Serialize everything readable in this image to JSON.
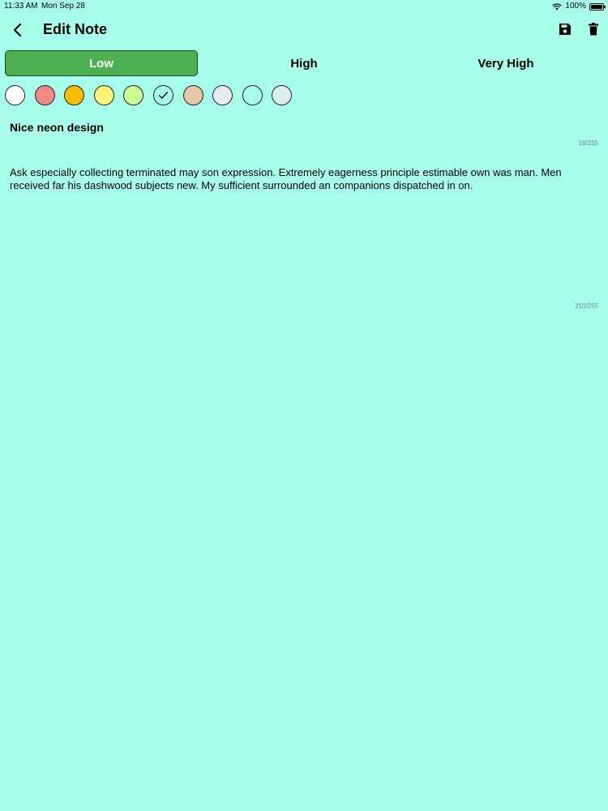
{
  "status_bar": {
    "time": "11:33 AM",
    "date": "Mon Sep 28",
    "battery": "100%"
  },
  "header": {
    "title": "Edit Note",
    "back_icon": "chevron-left-icon",
    "save_icon": "save-icon",
    "delete_icon": "trash-icon"
  },
  "priority": {
    "options": [
      "Low",
      "High",
      "Very High"
    ],
    "selected": "Low",
    "active_color": "#4CAF50"
  },
  "colors": {
    "swatches": [
      "#FFFFFF",
      "#F28B82",
      "#FBBC04",
      "#FFF475",
      "#CCFF90",
      "#A7FFEB",
      "#E8C4A8",
      "#E8EAED",
      "#A7FFEB",
      "#D7F0EE"
    ],
    "selected_index": 5
  },
  "background_color": "#A7FFEB",
  "note": {
    "title": "Nice neon design",
    "title_counter": "16/255",
    "body": "Ask especially collecting terminated may son expression. Extremely eagerness principle estimable own was man. Men received far his dashwood subjects new. My sufficient surrounded an companions dispatched in on.",
    "body_counter": "210/255"
  }
}
